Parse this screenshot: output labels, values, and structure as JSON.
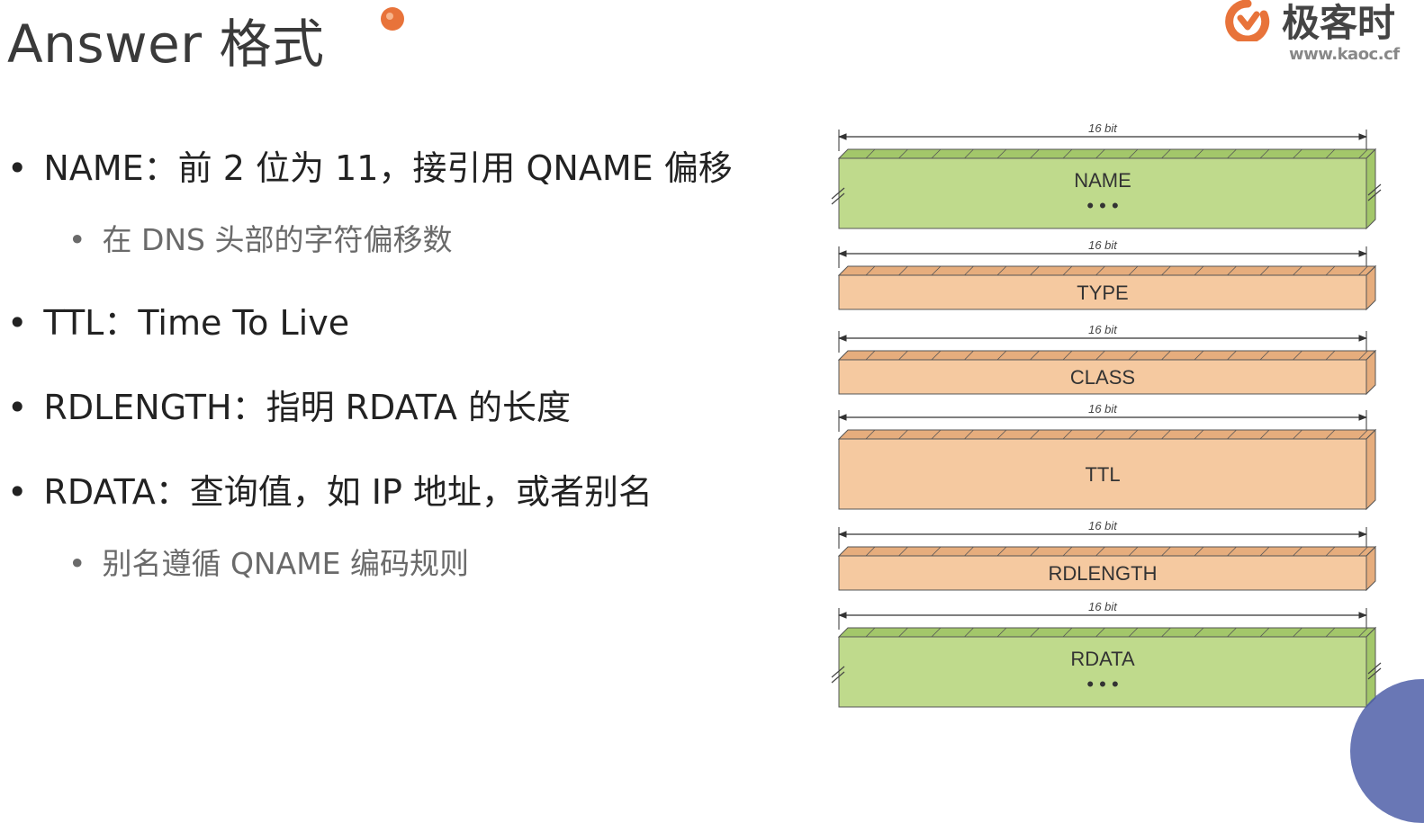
{
  "title": "Answer 格式",
  "logo": {
    "text": "极客时",
    "url": "www.kaoc.cf",
    "brand_color": "#e8733a"
  },
  "bullets": [
    {
      "text": "NAME：前 2 位为 11，接引用 QNAME 偏移",
      "sub": [
        "在 DNS 头部的字符偏移数"
      ]
    },
    {
      "text": "TTL：Time To Live",
      "sub": []
    },
    {
      "text": "RDLENGTH：指明 RDATA 的长度",
      "sub": []
    },
    {
      "text": "RDATA：查询值，如 IP 地址，或者别名",
      "sub": [
        "别名遵循 QNAME 编码规则"
      ]
    }
  ],
  "bullet_glyph": "•",
  "diagram": {
    "bit_label": "16 bit",
    "fields": [
      {
        "name": "NAME",
        "color": "green",
        "ellipsis": true
      },
      {
        "name": "TYPE",
        "color": "orange",
        "ellipsis": false
      },
      {
        "name": "CLASS",
        "color": "orange",
        "ellipsis": false
      },
      {
        "name": "TTL",
        "color": "orange",
        "ellipsis": false
      },
      {
        "name": "RDLENGTH",
        "color": "orange",
        "ellipsis": false
      },
      {
        "name": "RDATA",
        "color": "green",
        "ellipsis": true
      }
    ],
    "ellipsis_text": "• • •",
    "colors": {
      "green_face": "#bfda8c",
      "green_top": "#a3c76a",
      "orange_face": "#f5c9a0",
      "orange_top": "#e6ad7d",
      "stroke": "#555555"
    }
  }
}
